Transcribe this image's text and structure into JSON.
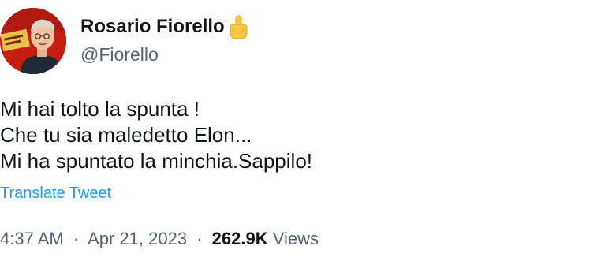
{
  "author": {
    "display_name": "Rosario Fiorello",
    "handle": "@Fiorello",
    "name_emoji_icon": "middle-finger-emoji-icon",
    "avatar_accent": "#c81e12"
  },
  "tweet": {
    "lines": [
      "Mi hai tolto la spunta !",
      "Che tu sia maledetto Elon...",
      "Mi ha spuntato la minchia.Sappilo!"
    ],
    "translate_label": "Translate Tweet"
  },
  "meta": {
    "time": "4:37 AM",
    "separator": "·",
    "date": "Apr 21, 2023",
    "views_count": "262.9K",
    "views_label": "Views"
  },
  "colors": {
    "text": "#0f1419",
    "secondary": "#536471",
    "link": "#1d9bf0"
  }
}
